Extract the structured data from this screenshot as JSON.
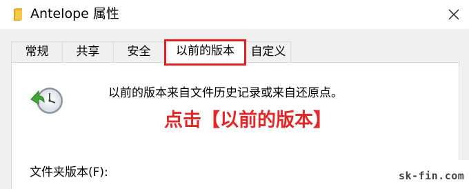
{
  "window": {
    "title": "Antelope 属性",
    "close_icon": "close-icon",
    "folder_icon": "folder-icon",
    "folder_color": "#e8b533"
  },
  "tabs": [
    {
      "label": "常规",
      "active": false
    },
    {
      "label": "共享",
      "active": false
    },
    {
      "label": "安全",
      "active": false
    },
    {
      "label": "以前的版本",
      "active": true
    },
    {
      "label": "自定义",
      "active": false
    }
  ],
  "content": {
    "icon": "history-restore-icon",
    "description": "以前的版本来自文件历史记录或来自还原点。",
    "field_label": "文件夹版本(F):"
  },
  "annotation": {
    "text": "点击【以前的版本】",
    "color": "#e02828"
  },
  "watermark": {
    "text": "sk-fin.com"
  }
}
